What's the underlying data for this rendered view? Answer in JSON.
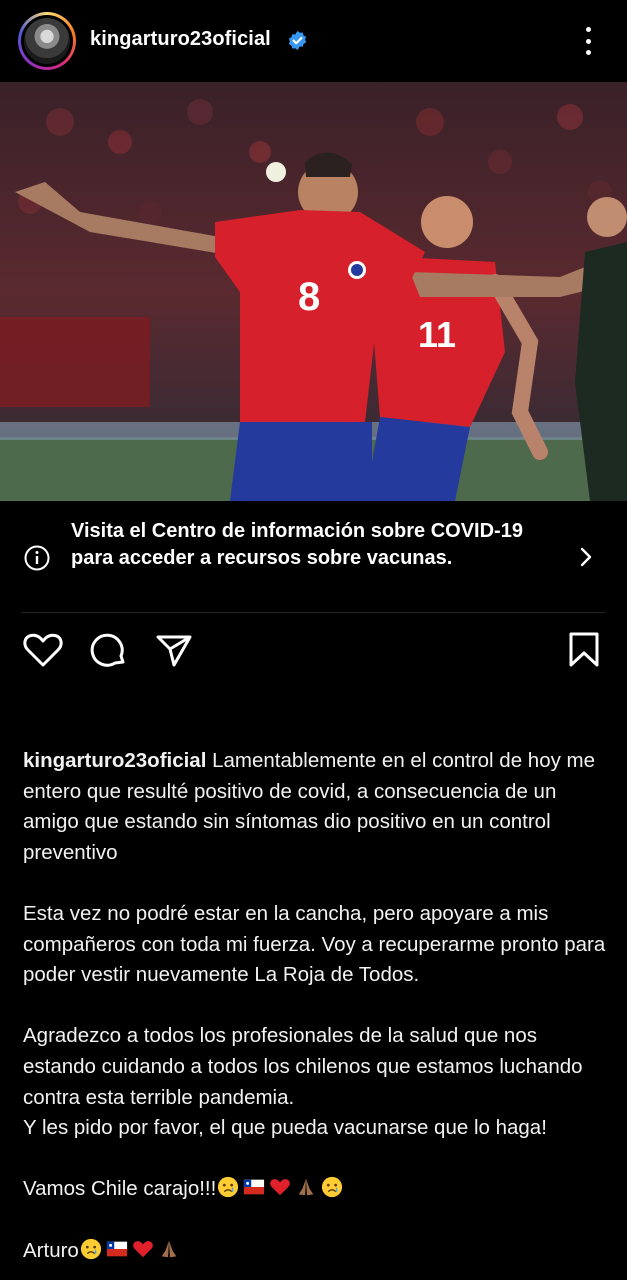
{
  "post": {
    "username": "kingarturo23oficial",
    "verified": true
  },
  "icons": {
    "avatar": "profile-avatar",
    "verified": "verified-badge-icon",
    "more": "more-vertical-icon",
    "info": "info-icon",
    "chevron": "chevron-right-icon",
    "like": "heart-icon",
    "comment": "comment-icon",
    "share": "share-paper-plane-icon",
    "save": "bookmark-icon"
  },
  "colors": {
    "background": "#000000",
    "verified_blue": "#3897f0",
    "text": "#ffffff",
    "divider": "#262626"
  },
  "covid_banner": {
    "text": "Visita el Centro de información sobre COVID-19 para acceder a recursos sobre vacunas."
  },
  "caption": {
    "username": "kingarturo23oficial",
    "paragraph1": "Lamentablemente en el control de hoy me entero que resulté positivo de covid, a consecuencia de un amigo que estando sin síntomas dio positivo en un control preventivo",
    "paragraph2": "Esta vez no podré estar en la cancha, pero apoyare a mis compañeros con toda mi fuerza. Voy a recuperarme pronto para poder vestir nuevamente La Roja de Todos.",
    "paragraph3a": "Agradezco a todos los profesionales de la salud que nos estando cuidando a todos los chilenos que estamos luchando contra esta terrible pandemia.",
    "paragraph3b": "Y les pido por favor, el que pueda vacunarse que lo haga!",
    "paragraph4": "Vamos Chile carajo!!!",
    "paragraph5": "Arturo"
  },
  "photo": {
    "jersey_numbers": [
      "8",
      "11"
    ]
  }
}
